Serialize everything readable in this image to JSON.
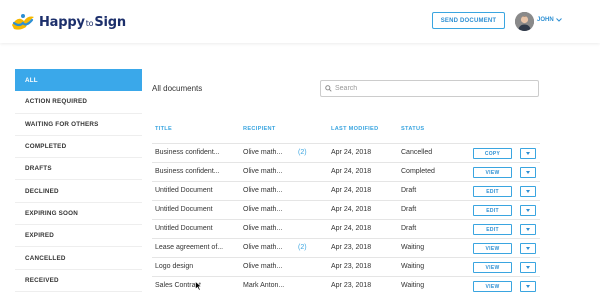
{
  "header": {
    "logo_text_a": "Happy",
    "logo_text_to": "to",
    "logo_text_b": "Sign",
    "send_button": "SEND DOCUMENT",
    "user_name": "JOHN",
    "user_chevron_icon": "chevron-down-icon"
  },
  "sidebar": {
    "items": [
      {
        "label": "ALL",
        "active": true
      },
      {
        "label": "ACTION REQUIRED"
      },
      {
        "label": "WAITING FOR OTHERS"
      },
      {
        "label": "COMPLETED"
      },
      {
        "label": "DRAFTS"
      },
      {
        "label": "DECLINED"
      },
      {
        "label": "EXPIRING SOON"
      },
      {
        "label": "EXPIRED"
      },
      {
        "label": "CANCELLED"
      },
      {
        "label": "RECEIVED"
      }
    ]
  },
  "main": {
    "title": "All documents",
    "search_placeholder": "Search",
    "columns": {
      "title": "TITLE",
      "recipient": "RECIPIENT",
      "modified": "LAST MODIFIED",
      "status": "STATUS"
    },
    "rows": [
      {
        "title": "Business confident...",
        "recipient": "Olive math...",
        "count": "(2)",
        "modified": "Apr 24, 2018",
        "status": "Cancelled",
        "action": "COPY"
      },
      {
        "title": "Business confident...",
        "recipient": "Olive math...",
        "count": "",
        "modified": "Apr 24, 2018",
        "status": "Completed",
        "action": "VIEW"
      },
      {
        "title": "Untitled Document",
        "recipient": "Olive math...",
        "count": "",
        "modified": "Apr 24, 2018",
        "status": "Draft",
        "action": "EDIT"
      },
      {
        "title": "Untitled Document",
        "recipient": "Olive math...",
        "count": "",
        "modified": "Apr 24, 2018",
        "status": "Draft",
        "action": "EDIT"
      },
      {
        "title": "Untitled Document",
        "recipient": "Olive math...",
        "count": "",
        "modified": "Apr 24, 2018",
        "status": "Draft",
        "action": "EDIT"
      },
      {
        "title": "Lease agreement of...",
        "recipient": "Olive math...",
        "count": "(2)",
        "modified": "Apr 23, 2018",
        "status": "Waiting",
        "action": "VIEW"
      },
      {
        "title": "Logo design",
        "recipient": "Olive math...",
        "count": "",
        "modified": "Apr 23, 2018",
        "status": "Waiting",
        "action": "VIEW"
      },
      {
        "title": "Sales Contract",
        "recipient": "Mark Anton...",
        "count": "",
        "modified": "Apr 23, 2018",
        "status": "Waiting",
        "action": "VIEW"
      }
    ]
  },
  "colors": {
    "accent": "#3aa8ea",
    "brand_navy": "#1c2f6b",
    "logo_yellow": "#f5b800"
  }
}
